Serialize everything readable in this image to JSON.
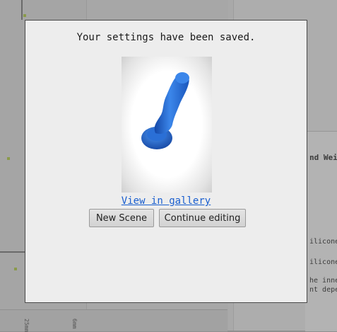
{
  "modal": {
    "message": "Your settings have been saved.",
    "preview_icon": "blue-3d-model",
    "gallery_link": "View in gallery",
    "buttons": {
      "new_scene": "New Scene",
      "continue_editing": "Continue editing"
    }
  },
  "background": {
    "section_heading": "nd Wei",
    "text_1": "ilicone,",
    "text_2": "ilicone",
    "text_3": "he inne",
    "text_4": "nt depen",
    "ruler_1": "25mm",
    "ruler_2": "6mm"
  },
  "colors": {
    "model_blue": "#2a6fd6",
    "link_blue": "#1a5fcf"
  }
}
